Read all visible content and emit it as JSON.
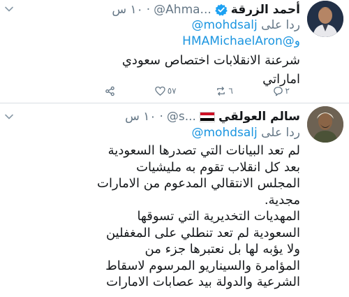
{
  "tweets": [
    {
      "name": "أحمد الزرقة",
      "handle": "@Ahma...",
      "time": "١٠ س",
      "verified": true,
      "reply_prefix": "ردا على",
      "mentions": [
        "@mohdsalj",
        "و@HMAMichaelAron"
      ],
      "body": [
        "شرعنة الانقلابات اختصاص سعودي",
        "اماراتي"
      ],
      "actions": {
        "reply_count": "٢",
        "retweet_count": "٦",
        "like_count": "٥٧"
      }
    },
    {
      "name": "سالم العولقي",
      "handle": "@s...",
      "time": "١٠ س",
      "flag": "yemen-flag",
      "reply_prefix": "ردا على",
      "mentions": [
        "@mohdsalj"
      ],
      "body": [
        "لم تعد البيانات التي تصدرها السعودية",
        "بعد كل انقلاب تقوم به مليشيات",
        "المجلس الانتقالي المدعوم من الامارات",
        "مجدية.",
        "المهديات التخديرية التي تسوقها",
        "السعودية لم تعد تنطلي على المغفلين",
        "ولا يؤبه لها بل نعتبرها جزء من",
        "المؤامرة والسيناريو المرسوم لاسقاط",
        "الشرعية والدولة بيد عصابات الامارات"
      ]
    }
  ],
  "colors": {
    "link": "#1b95e0",
    "secondary": "#657786",
    "text": "#14171a",
    "verified": "#1da1f2"
  }
}
